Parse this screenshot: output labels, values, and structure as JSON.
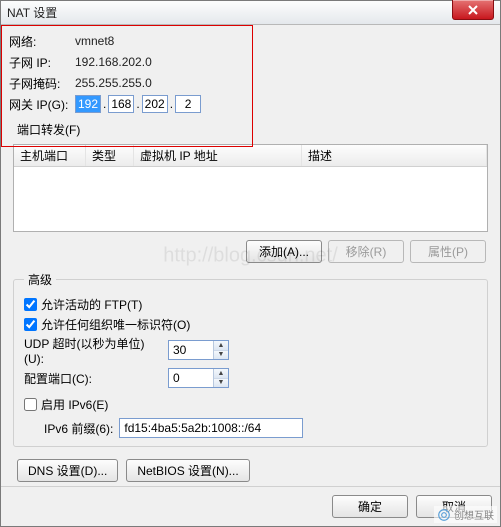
{
  "window": {
    "title": "NAT 设置"
  },
  "info": {
    "network_label": "网络:",
    "network_value": "vmnet8",
    "subnet_ip_label": "子网 IP:",
    "subnet_ip_value": "192.168.202.0",
    "subnet_mask_label": "子网掩码:",
    "subnet_mask_value": "255.255.255.0",
    "gateway_label": "网关 IP(G):",
    "gateway_octets": [
      "192",
      "168",
      "202",
      "2"
    ]
  },
  "port_forward": {
    "label": "端口转发(F)",
    "headers": {
      "host_port": "主机端口",
      "type": "类型",
      "vm_ip": "虚拟机 IP 地址",
      "desc": "描述"
    },
    "buttons": {
      "add": "添加(A)...",
      "remove": "移除(R)",
      "props": "属性(P)"
    }
  },
  "advanced": {
    "legend": "高级",
    "allow_active_ftp": "允许活动的 FTP(T)",
    "allow_active_ftp_checked": true,
    "allow_oui": "允许任何组织唯一标识符(O)",
    "allow_oui_checked": true,
    "udp_timeout_label": "UDP 超时(以秒为单位)(U):",
    "udp_timeout_value": "30",
    "config_port_label": "配置端口(C):",
    "config_port_value": "0",
    "enable_ipv6_label": "启用 IPv6(E)",
    "enable_ipv6_checked": false,
    "ipv6_prefix_label": "IPv6 前缀(6):",
    "ipv6_prefix_value": "fd15:4ba5:5a2b:1008::/64"
  },
  "bottom": {
    "dns": "DNS 设置(D)...",
    "netbios": "NetBIOS 设置(N)..."
  },
  "footer": {
    "ok": "确定",
    "cancel": "取消"
  },
  "watermark": "http://blog.csdn.net/",
  "corner_brand": "创想互联"
}
